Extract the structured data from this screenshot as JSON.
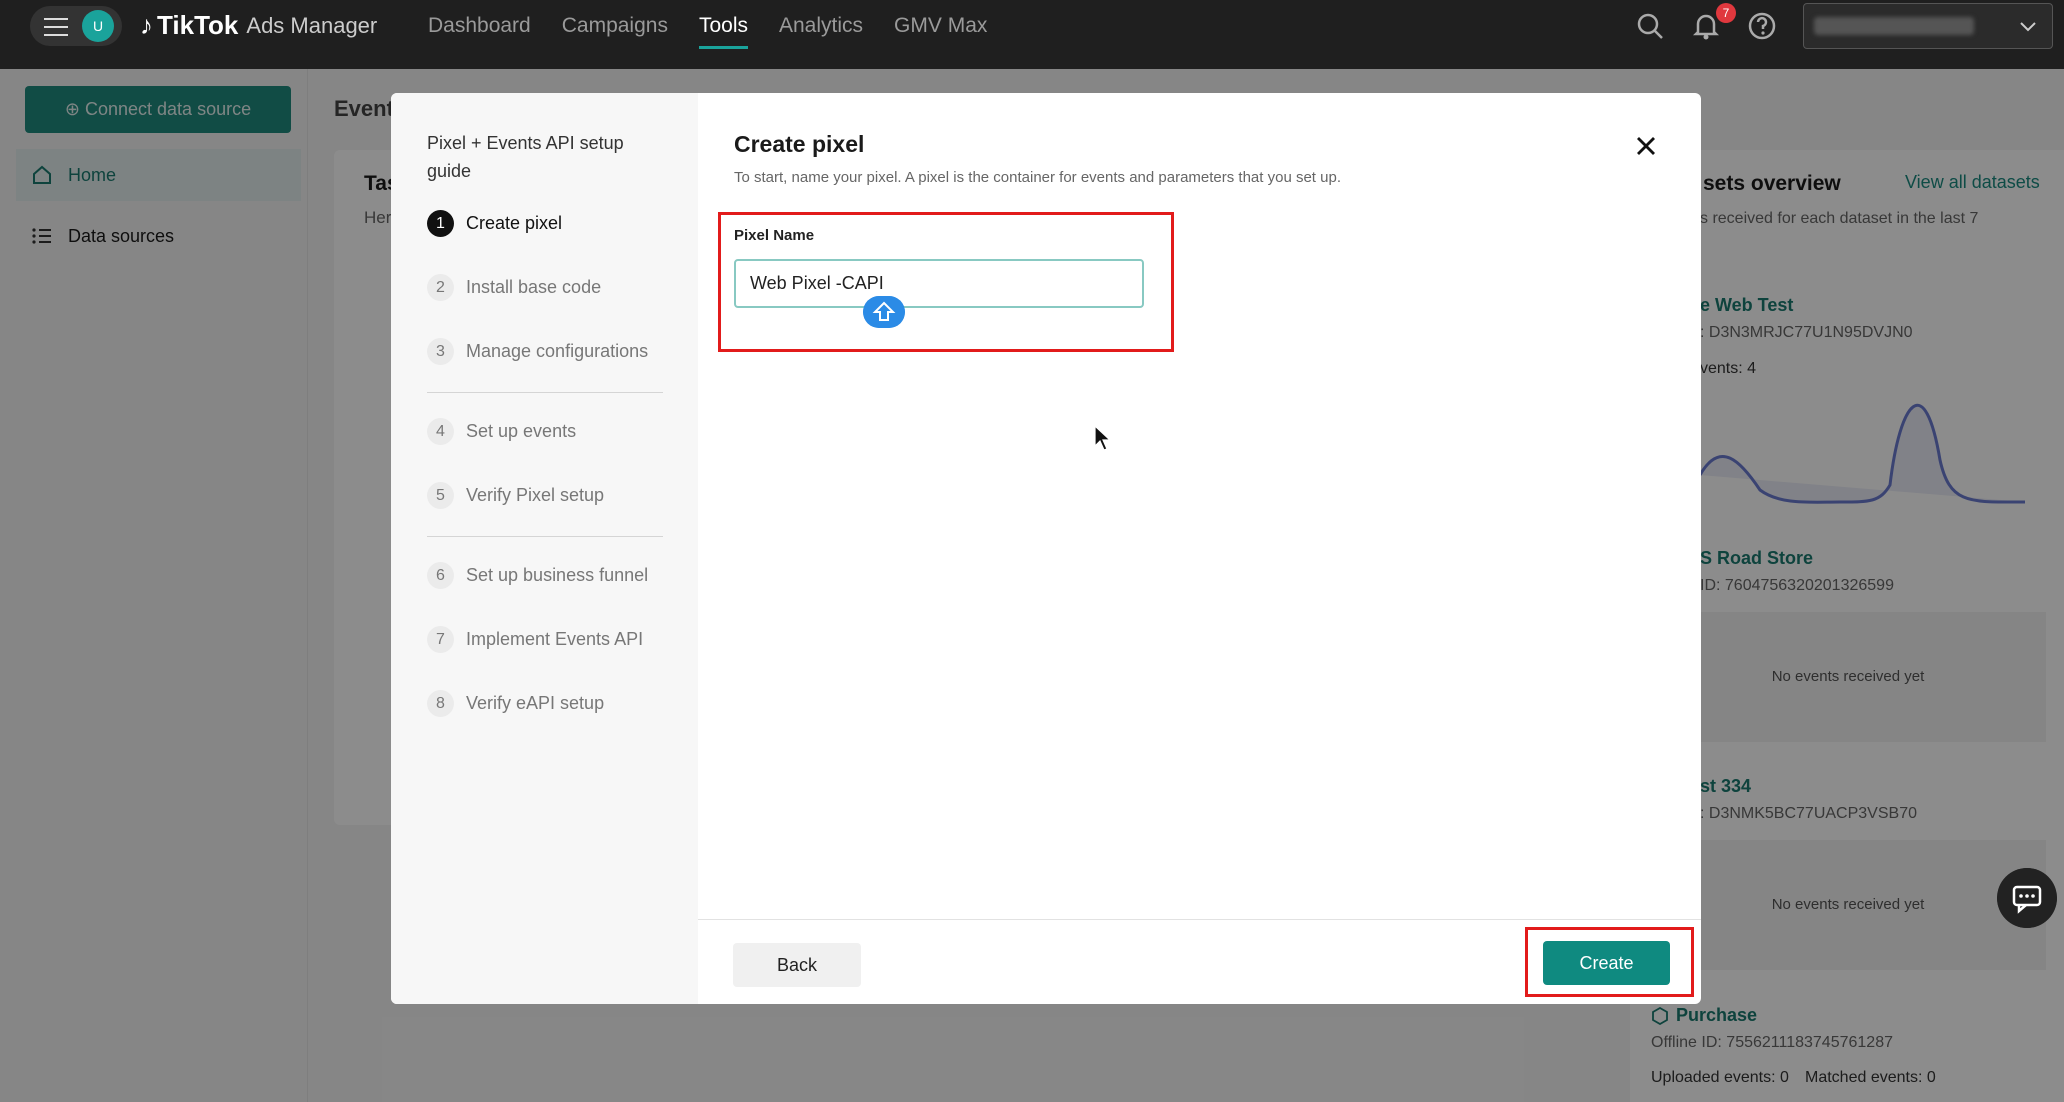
{
  "topbar": {
    "user_initial": "U",
    "brand": "TikTok",
    "product": "Ads Manager",
    "nav": [
      "Dashboard",
      "Campaigns",
      "Tools",
      "Analytics",
      "GMV Max"
    ],
    "active_nav": "Tools",
    "notification_count": "7"
  },
  "sidebar": {
    "connect_button": "Connect data source",
    "items": [
      {
        "label": "Home",
        "icon": "home-icon"
      },
      {
        "label": "Data sources",
        "icon": "list-icon"
      }
    ]
  },
  "background": {
    "page_title_partial": "Event",
    "card_title_partial": "Tas",
    "card_sub_partial": "Her",
    "datasets_title_partial": "sets overview",
    "view_all": "View all datasets",
    "datasets_sub_partial": "s received for each dataset in the last 7",
    "datasets": [
      {
        "name_partial": "e Web Test",
        "id_partial": ": D3N3MRJC77U1N95DVJN0",
        "events_partial": "vents: 4"
      },
      {
        "name_partial": "S Road Store",
        "id_partial": "ID: 7604756320201326599",
        "empty": "No events received yet"
      },
      {
        "name_partial": "st 334",
        "id_partial": ": D3NMK5BC77UACP3VSB70",
        "empty": "No events received yet"
      }
    ],
    "purchase": {
      "name": "Purchase",
      "offline_id": "Offline ID: 7556211183745761287",
      "uploaded": "Uploaded events: 0",
      "matched": "Matched events: 0"
    }
  },
  "modal": {
    "guide_title": "Pixel + Events API setup guide",
    "steps": [
      {
        "num": "1",
        "label": "Create pixel"
      },
      {
        "num": "2",
        "label": "Install base code"
      },
      {
        "num": "3",
        "label": "Manage configurations"
      },
      {
        "num": "4",
        "label": "Set up events"
      },
      {
        "num": "5",
        "label": "Verify Pixel setup"
      },
      {
        "num": "6",
        "label": "Set up business funnel"
      },
      {
        "num": "7",
        "label": "Implement Events API"
      },
      {
        "num": "8",
        "label": "Verify eAPI setup"
      }
    ],
    "title": "Create pixel",
    "description": "To start, name your pixel. A pixel is the container for events and parameters that you set up.",
    "field_label": "Pixel Name",
    "field_value": "Web Pixel -CAPI",
    "back": "Back",
    "create": "Create"
  },
  "colors": {
    "accent": "#0f8a80",
    "highlight": "#e21b1b",
    "topbar": "#1f1f1f"
  }
}
